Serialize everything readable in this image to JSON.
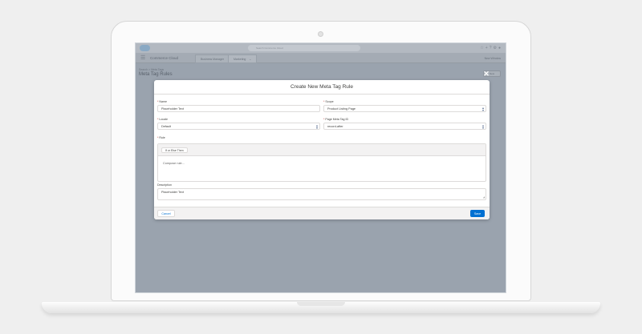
{
  "app": {
    "search_placeholder": "Search Commerce Cloud",
    "name": "Commerce Cloud",
    "tabs": [
      {
        "label": "Business Manager"
      },
      {
        "label": "Marketing"
      }
    ],
    "nav_right": "New Window",
    "breadcrumb": "Search > Meta Tags",
    "page_title": "Meta Tag Rules",
    "new_button": "New"
  },
  "modal": {
    "title": "Create New Meta Tag Rule",
    "fields": {
      "name": {
        "label": "Name",
        "value": "Placeholder Text"
      },
      "scope": {
        "label": "Scope",
        "value": "Product Listing Page"
      },
      "locale": {
        "label": "Locale",
        "value": "Default"
      },
      "page_meta_tag_id": {
        "label": "Page Meta Tag ID",
        "value": "record-after"
      },
      "rule": {
        "label": "Rule",
        "chip": "If or Else Then",
        "placeholder": "Compose rule..."
      },
      "description": {
        "label": "Description",
        "value": "Placeholder Text"
      }
    },
    "cancel_label": "Cancel",
    "save_label": "Save",
    "close_symbol": "✕"
  },
  "colors": {
    "brand_blue": "#0070d2",
    "overlay": "#9aa3ae",
    "required": "#c23934"
  }
}
